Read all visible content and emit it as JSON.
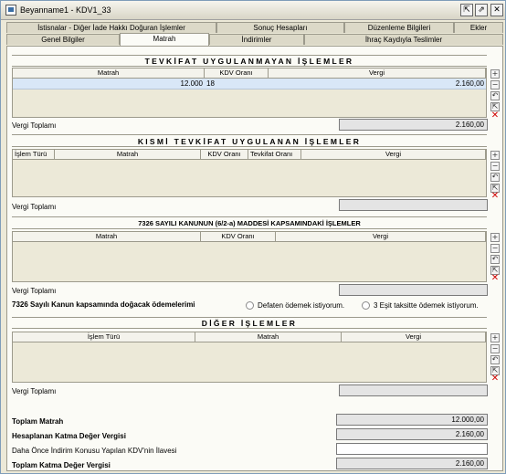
{
  "window": {
    "title": "Beyanname1 - KDV1_33",
    "btn_restore": "⇱",
    "btn_maximize": "⇗",
    "btn_close": "✕"
  },
  "tabs": {
    "row1": [
      "İstisnalar - Diğer İade Hakkı Doğuran İşlemler",
      "Sonuç Hesapları",
      "Düzenleme Bilgileri",
      "Ekler"
    ],
    "row2": [
      "Genel Bilgiler",
      "Matrah",
      "İndirimler",
      "İhraç Kaydıyla Teslimler"
    ],
    "active": "Matrah"
  },
  "side_buttons": {
    "add": "+",
    "remove": "−",
    "undo": "↶",
    "edit": "⇱",
    "delete": "✕"
  },
  "sec1": {
    "title": "TEVKİFAT UYGULANMAYAN İŞLEMLER",
    "columns": [
      "Matrah",
      "KDV Oranı",
      "Vergi"
    ],
    "rows": [
      {
        "matrah": "12.000",
        "kdv": "18",
        "vergi": "2.160,00"
      }
    ],
    "total_label": "Vergi Toplamı",
    "total_value": "2.160,00"
  },
  "sec2": {
    "title": "KISMİ TEVKİFAT UYGULANAN İŞLEMLER",
    "columns": [
      "İşlem Türü",
      "Matrah",
      "KDV Oranı",
      "Tevkifat Oranı",
      "Vergi"
    ],
    "total_label": "Vergi Toplamı",
    "total_value": ""
  },
  "sec3": {
    "title": "7326 SAYILI KANUNUN (6/2-a) MADDESİ KAPSAMINDAKİ İŞLEMLER",
    "columns": [
      "Matrah",
      "KDV Oranı",
      "Vergi"
    ],
    "total_label": "Vergi Toplamı",
    "total_value": "",
    "payment_label": "7326 Sayılı Kanun kapsamında doğacak ödemelerimi",
    "option1": "Defaten ödemek istiyorum.",
    "option2": "3 Eşit taksitte ödemek istiyorum."
  },
  "sec4": {
    "title": "DİĞER İŞLEMLER",
    "columns": [
      "İşlem Türü",
      "Matrah",
      "Vergi"
    ],
    "total_label": "Vergi Toplamı",
    "total_value": ""
  },
  "summary": {
    "toplam_matrah_label": "Toplam Matrah",
    "toplam_matrah_value": "12.000,00",
    "hesaplanan_label": "Hesaplanan Katma Değer Vergisi",
    "hesaplanan_value": "2.160,00",
    "daha_once_label": "Daha Önce İndirim Konusu Yapılan KDV'nin İlavesi",
    "daha_once_value": "",
    "toplam_kdv_label": "Toplam Katma Değer Vergisi",
    "toplam_kdv_value": "2.160,00"
  }
}
